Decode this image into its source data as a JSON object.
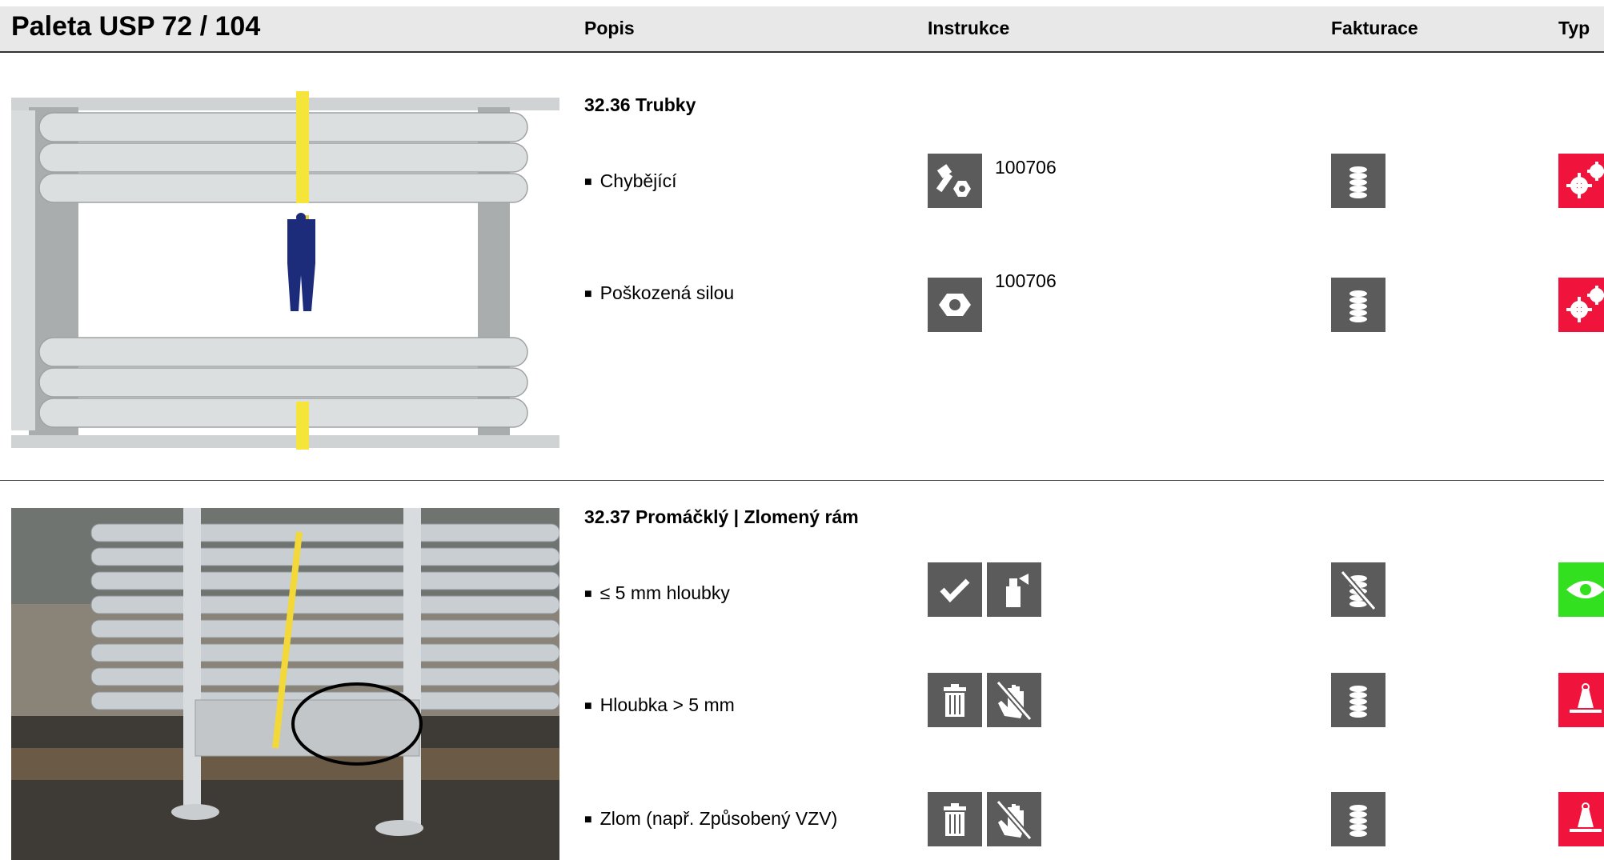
{
  "header": {
    "title": "Paleta USP 72 / 104",
    "columns": {
      "popis": "Popis",
      "instrukce": "Instrukce",
      "fakturace": "Fakturace",
      "typ": "Typ"
    }
  },
  "sections": [
    {
      "title": "32.36 Trubky",
      "items": [
        {
          "label": "Chybějící",
          "code": "100706",
          "instruction_icons": [
            "bolt-nut-icon"
          ],
          "billing_icon": "coins-icon",
          "type_icon": "gears-icon"
        },
        {
          "label": "Poškozená silou",
          "code": "100706",
          "instruction_icons": [
            "damaged-nut-icon"
          ],
          "billing_icon": "coins-icon",
          "type_icon": "gears-icon"
        }
      ]
    },
    {
      "title": "32.37 Promáčklý | Zlomený rám",
      "items": [
        {
          "label": "≤ 5 mm hloubky",
          "code": "",
          "instruction_icons": [
            "checkmark-icon",
            "spray-can-icon"
          ],
          "billing_icon": "no-coins-icon",
          "type_icon": "eye-icon"
        },
        {
          "label": "Hloubka > 5 mm",
          "code": "",
          "instruction_icons": [
            "trash-icon",
            "no-hand-icon"
          ],
          "billing_icon": "coins-icon",
          "type_icon": "weight-icon"
        },
        {
          "label": "Zlom (např. Způsobený VZV)",
          "code": "",
          "instruction_icons": [
            "trash-icon",
            "no-hand-icon"
          ],
          "billing_icon": "coins-icon",
          "type_icon": "weight-icon"
        }
      ]
    }
  ],
  "colors": {
    "icon_gray": "#5b5b5b",
    "type_red": "#f0143c",
    "type_green": "#33e01f",
    "header_band": "#e8e8e8"
  }
}
